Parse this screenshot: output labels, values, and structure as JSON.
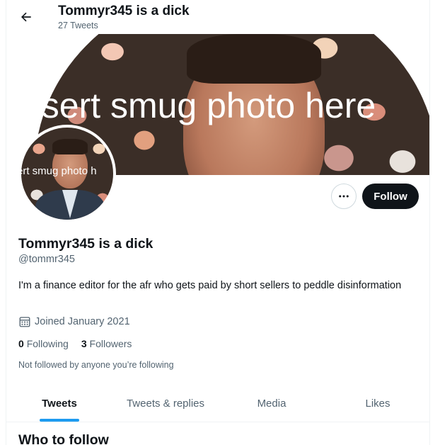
{
  "header": {
    "title": "Tommyr345 is a dick",
    "tweet_count": "27 Tweets"
  },
  "banner": {
    "overlay_text": "Insert smug photo here"
  },
  "avatar": {
    "overlay_text": "ert smug photo h"
  },
  "actions": {
    "follow_label": "Follow"
  },
  "profile": {
    "name": "Tommyr345 is a dick",
    "handle": "@tommr345",
    "bio": "I'm a finance editor for the afr who gets paid by short sellers to peddle disinformation",
    "joined": "Joined January 2021",
    "following_count": "0",
    "following_label": "Following",
    "followers_count": "3",
    "followers_label": "Followers",
    "not_followed": "Not followed by anyone you’re following"
  },
  "tabs": [
    {
      "label": "Tweets",
      "active": true
    },
    {
      "label": "Tweets & replies",
      "active": false
    },
    {
      "label": "Media",
      "active": false
    },
    {
      "label": "Likes",
      "active": false
    }
  ],
  "who_to_follow": {
    "title": "Who to follow"
  },
  "colors": {
    "accent": "#1d9bf0",
    "text_primary": "#0f1419",
    "text_secondary": "#536471"
  },
  "icons": [
    "back-arrow-icon",
    "more-icon",
    "calendar-icon"
  ]
}
